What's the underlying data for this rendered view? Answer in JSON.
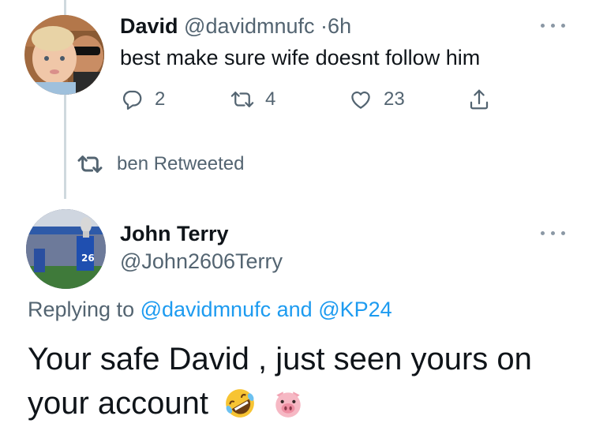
{
  "tweet1": {
    "name": "David",
    "handle": "@davidmnufc",
    "separator": "·",
    "time": "6h",
    "text": "best make sure wife doesnt follow him",
    "replies": "2",
    "retweets": "4",
    "likes": "23"
  },
  "retweet_context": {
    "text": "ben Retweeted"
  },
  "tweet2": {
    "name": "John Terry",
    "handle": "@John2606Terry",
    "replying_prefix": "Replying to",
    "reply_to_1": "@davidmnufc",
    "reply_and": "and",
    "reply_to_2": "@KP24",
    "text": "Your safe David , just seen yours on your account",
    "emojis": [
      "rolling-on-floor-laughing",
      "pig-face"
    ]
  },
  "colors": {
    "text": "#0f1419",
    "secondary": "#536471",
    "link": "#1d9bf0",
    "thread_line": "#cfd9de"
  },
  "icons": [
    "reply-icon",
    "retweet-icon",
    "like-icon",
    "share-icon",
    "more-icon"
  ]
}
